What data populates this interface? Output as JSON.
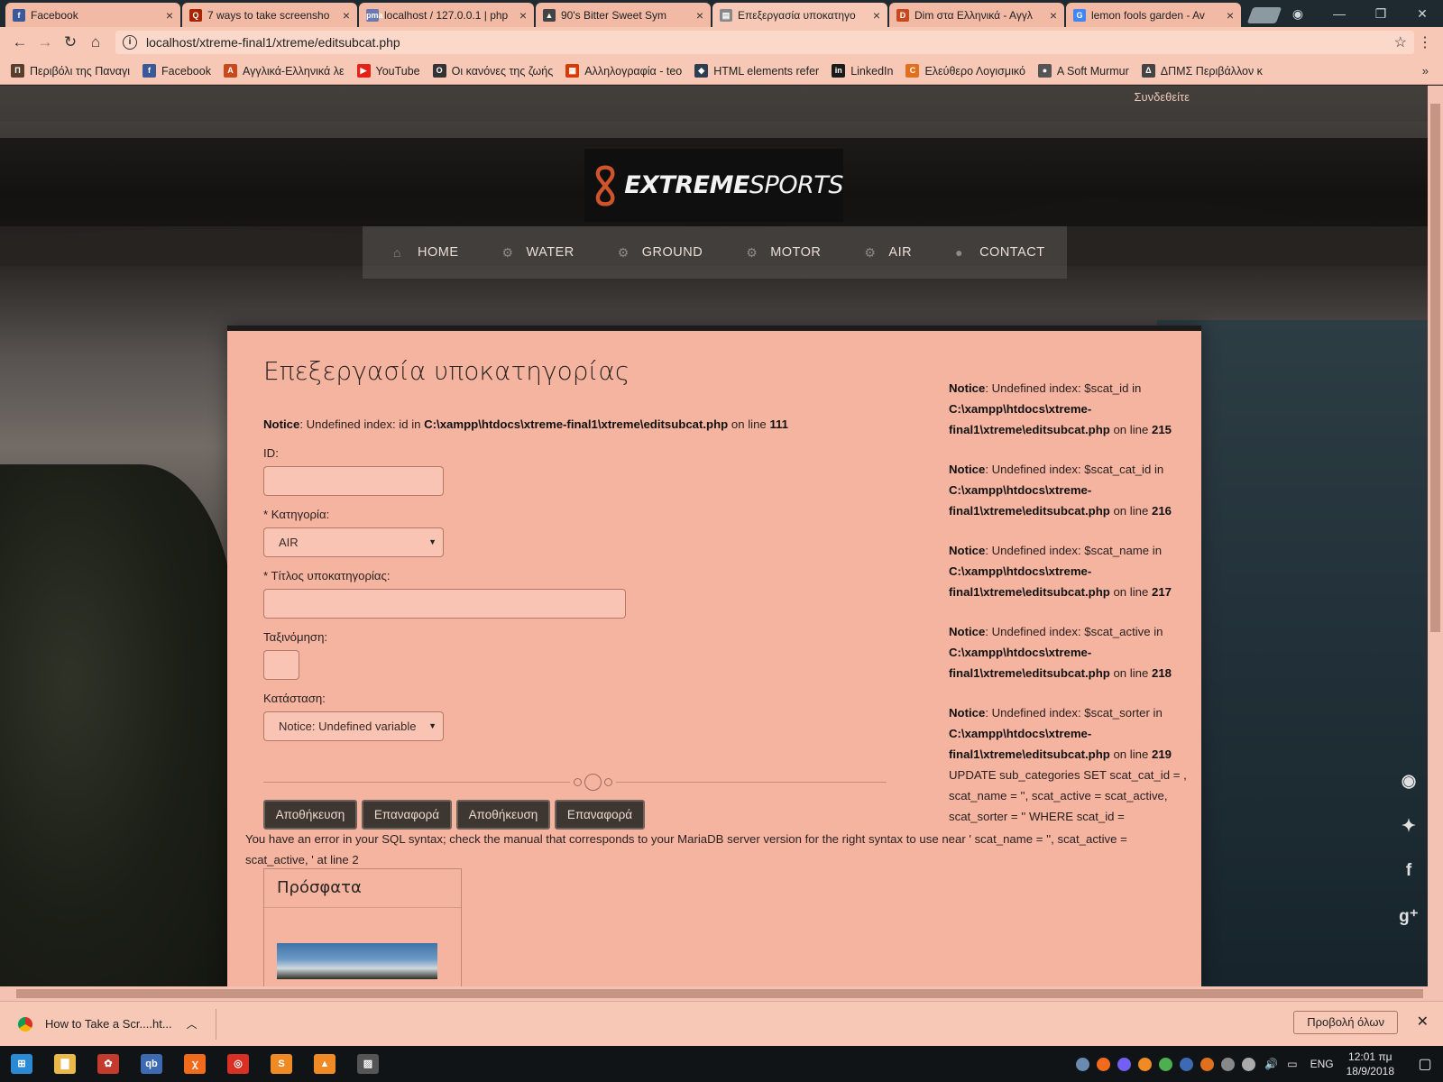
{
  "browser": {
    "tabs": [
      {
        "title": "Facebook",
        "icon": "facebook-icon",
        "color": "#3b5998",
        "glyph": "f"
      },
      {
        "title": "7 ways to take screensho",
        "icon": "quora-icon",
        "color": "#a82400",
        "glyph": "Q"
      },
      {
        "title": "localhost / 127.0.0.1 | php",
        "icon": "phpmyadmin-icon",
        "color": "#6c78af",
        "glyph": "pma"
      },
      {
        "title": "90's Bitter Sweet Sym",
        "icon": "music-icon",
        "color": "#444444",
        "glyph": "▲"
      },
      {
        "title": "Επεξεργασία υποκατηγο",
        "icon": "page-icon",
        "color": "#888888",
        "glyph": "▤"
      },
      {
        "title": "Dim στα Ελληνικά - Αγγλ",
        "icon": "dictionary-icon",
        "color": "#c74a1e",
        "glyph": "D"
      },
      {
        "title": "lemon fools garden - Av",
        "icon": "google-icon",
        "color": "#4285f4",
        "glyph": "G"
      }
    ],
    "active_tab_index": 4,
    "url": "localhost/xtreme-final1/xtreme/editsubcat.php",
    "bookmarks": [
      {
        "label": "Περιβόλι της Παναγι",
        "color": "#5a3d2b",
        "glyph": "Π"
      },
      {
        "label": "Facebook",
        "color": "#3b5998",
        "glyph": "f"
      },
      {
        "label": "Αγγλικά-Ελληνικά λε",
        "color": "#c74a1e",
        "glyph": "A"
      },
      {
        "label": "YouTube",
        "color": "#e62117",
        "glyph": "▶"
      },
      {
        "label": "Οι κανόνες της ζωής",
        "color": "#333333",
        "glyph": "Ο"
      },
      {
        "label": "Αλληλογραφία - teo",
        "color": "#d83b01",
        "glyph": "▦"
      },
      {
        "label": "HTML elements refer",
        "color": "#2c3e50",
        "glyph": "◆"
      },
      {
        "label": "LinkedIn",
        "color": "#1a1a1a",
        "glyph": "in"
      },
      {
        "label": "Ελεύθερο Λογισμικό",
        "color": "#e0701e",
        "glyph": "C"
      },
      {
        "label": "A Soft Murmur",
        "color": "#555555",
        "glyph": "●"
      },
      {
        "label": "ΔΠΜΣ Περιβάλλον κ",
        "color": "#444444",
        "glyph": "Δ"
      }
    ]
  },
  "site": {
    "login_link": "Συνδεθείτε",
    "logo_extreme": "EXTREME",
    "logo_sports": "SPORTS",
    "nav": [
      {
        "label": "HOME",
        "icon": "home-icon",
        "glyph": "⌂"
      },
      {
        "label": "WATER",
        "icon": "gears-icon",
        "glyph": "⚙"
      },
      {
        "label": "GROUND",
        "icon": "gears-icon",
        "glyph": "⚙"
      },
      {
        "label": "MOTOR",
        "icon": "gears-icon",
        "glyph": "⚙"
      },
      {
        "label": "AIR",
        "icon": "gears-icon",
        "glyph": "⚙"
      },
      {
        "label": "CONTACT",
        "icon": "speech-bubble-icon",
        "glyph": "●"
      }
    ]
  },
  "form": {
    "title": "Επεξεργασία υποκατηγορίας",
    "notice_id": {
      "prefix": "Notice",
      "text": ": Undefined index: id in ",
      "path": "C:\\xampp\\htdocs\\xtreme-final1\\xtreme\\editsubcat.php",
      "on": " on line ",
      "line": "111"
    },
    "id_label": "ID:",
    "category_label": "* Κατηγορία:",
    "category_value": "AIR",
    "subtitle_label": "* Τίτλος υποκατηγορίας:",
    "sort_label": "Ταξινόμηση:",
    "status_label": "Κατάσταση:",
    "status_value": "Notice: Undefined variable",
    "buttons": [
      "Αποθήκευση",
      "Επαναφορά",
      "Αποθήκευση",
      "Επαναφορά"
    ],
    "sql_error": "You have an error in your SQL syntax; check the manual that corresponds to your MariaDB server version for the right syntax to use near ' scat_name = '', scat_active = scat_active, ' at line 2"
  },
  "side_notices": [
    {
      "prefix": "Notice",
      "text": ": Undefined index: $scat_id in",
      "path1": "C:\\xampp\\htdocs\\xtreme-",
      "path2": "final1\\xtreme\\editsubcat.php",
      "on": " on line ",
      "line": "215"
    },
    {
      "prefix": "Notice",
      "text": ": Undefined index: $scat_cat_id in",
      "path1": "C:\\xampp\\htdocs\\xtreme-",
      "path2": "final1\\xtreme\\editsubcat.php",
      "on": " on line ",
      "line": "216"
    },
    {
      "prefix": "Notice",
      "text": ": Undefined index: $scat_name in",
      "path1": "C:\\xampp\\htdocs\\xtreme-",
      "path2": "final1\\xtreme\\editsubcat.php",
      "on": " on line ",
      "line": "217"
    },
    {
      "prefix": "Notice",
      "text": ": Undefined index: $scat_active in",
      "path1": "C:\\xampp\\htdocs\\xtreme-",
      "path2": "final1\\xtreme\\editsubcat.php",
      "on": " on line ",
      "line": "218"
    },
    {
      "prefix": "Notice",
      "text": ": Undefined index: $scat_sorter in",
      "path1": "C:\\xampp\\htdocs\\xtreme-",
      "path2": "final1\\xtreme\\editsubcat.php",
      "on": " on line ",
      "line": "219"
    }
  ],
  "update_query": [
    "UPDATE sub_categories SET scat_cat_id = ,",
    "scat_name = '', scat_active = scat_active,",
    "scat_sorter = '' WHERE scat_id ="
  ],
  "recent": {
    "title": "Πρόσφατα"
  },
  "social": [
    {
      "icon": "rss-icon",
      "glyph": "◉"
    },
    {
      "icon": "twitter-icon",
      "glyph": "✦"
    },
    {
      "icon": "facebook-icon",
      "glyph": "f"
    },
    {
      "icon": "google-plus-icon",
      "glyph": "g⁺"
    }
  ],
  "download_bar": {
    "file": "How to Take a Scr....ht...",
    "show_all": "Προβολή όλων"
  },
  "taskbar": {
    "apps": [
      {
        "icon": "windows-start-icon",
        "color": "#2a8ad4",
        "glyph": "⊞"
      },
      {
        "icon": "file-explorer-icon",
        "color": "#e8b84a",
        "glyph": "▇"
      },
      {
        "icon": "popcorn-icon",
        "color": "#c23b2d",
        "glyph": "✿"
      },
      {
        "icon": "qbittorrent-icon",
        "color": "#3d6ab3",
        "glyph": "qb"
      },
      {
        "icon": "xampp-icon",
        "color": "#f26b1d",
        "glyph": "ꭓ"
      },
      {
        "icon": "chrome-icon",
        "color": "#d93025",
        "glyph": "◎"
      },
      {
        "icon": "sublime-icon",
        "color": "#f08a24",
        "glyph": "S"
      },
      {
        "icon": "vlc-icon",
        "color": "#f08a24",
        "glyph": "▲"
      },
      {
        "icon": "photos-icon",
        "color": "#555555",
        "glyph": "▨"
      }
    ],
    "language": "ENG",
    "time": "12:01 πμ",
    "date": "18/9/2018"
  }
}
